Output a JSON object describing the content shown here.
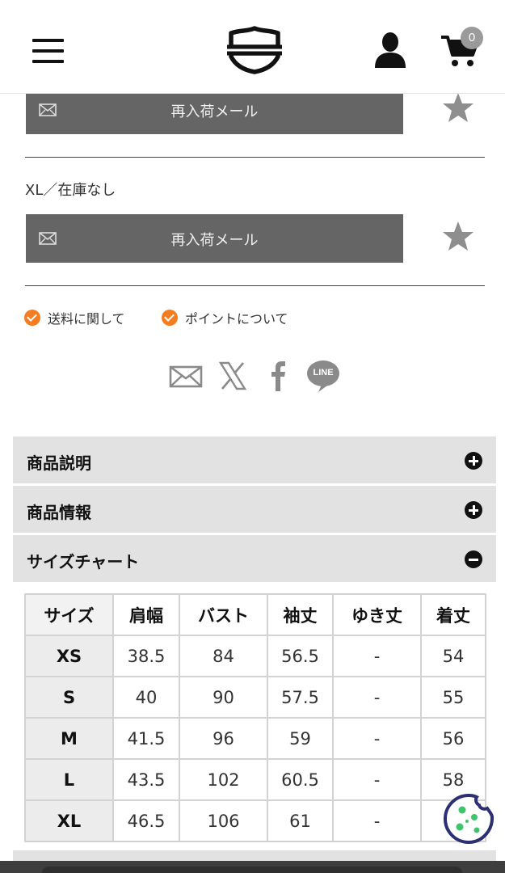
{
  "header": {
    "cart_count": "0"
  },
  "notify": [
    {
      "label": "再入荷メール"
    },
    {
      "label": "再入荷メール"
    }
  ],
  "size_status": "XL／在庫なし",
  "info_links": [
    {
      "label": "送料に関して"
    },
    {
      "label": "ポイントについて"
    }
  ],
  "share": {
    "icons": [
      "mail-icon",
      "x-icon",
      "facebook-icon",
      "line-icon"
    ],
    "line_text": "LINE"
  },
  "accordions": [
    {
      "title": "商品説明",
      "state": "collapsed"
    },
    {
      "title": "商品情報",
      "state": "collapsed"
    },
    {
      "title": "サイズチャート",
      "state": "expanded"
    }
  ],
  "size_chart": {
    "headers": [
      "サイズ",
      "肩幅",
      "バスト",
      "袖丈",
      "ゆき丈",
      "着丈"
    ],
    "rows": [
      {
        "size": "XS",
        "values": [
          "38.5",
          "84",
          "56.5",
          "-",
          "54"
        ]
      },
      {
        "size": "S",
        "values": [
          "40",
          "90",
          "57.5",
          "-",
          "55"
        ]
      },
      {
        "size": "M",
        "values": [
          "41.5",
          "96",
          "59",
          "-",
          "56"
        ]
      },
      {
        "size": "L",
        "values": [
          "43.5",
          "102",
          "60.5",
          "-",
          "58"
        ]
      },
      {
        "size": "XL",
        "values": [
          "46.5",
          "106",
          "61",
          "-",
          ""
        ]
      }
    ]
  },
  "colors": {
    "button_gray": "#656565",
    "accent_orange": "#f57c1f",
    "accordion_bg": "#e2e2e2",
    "cookie_navy": "#2b2f73",
    "cookie_green": "#3ec46d"
  }
}
